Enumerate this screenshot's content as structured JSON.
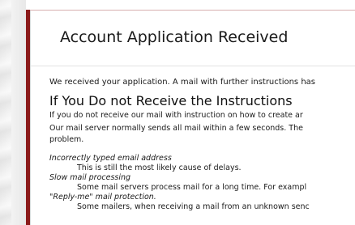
{
  "page": {
    "title": "Account Application Received",
    "intro": "We received your application. A mail with further instructions has",
    "section_heading": "If You Do not Receive the Instructions",
    "paragraph_1": "If you do not receive our mail with instruction on how to create ar",
    "paragraph_2_line_1": "Our mail server normally sends all mail within a few seconds. The",
    "paragraph_2_line_2": "problem."
  },
  "reasons": [
    {
      "term": "Incorrectly typed email address",
      "description": "This is still the most likely cause of delays."
    },
    {
      "term": "Slow mail processing",
      "description": "Some mail servers process mail for a long time. For exampl"
    },
    {
      "term": "\"Reply-me\" mail protection.",
      "description": "Some mailers, when receiving a mail from an unknown senc"
    }
  ],
  "colors": {
    "accent": "#8b1a1a",
    "text": "#1a1a1a",
    "background": "#ffffff"
  }
}
